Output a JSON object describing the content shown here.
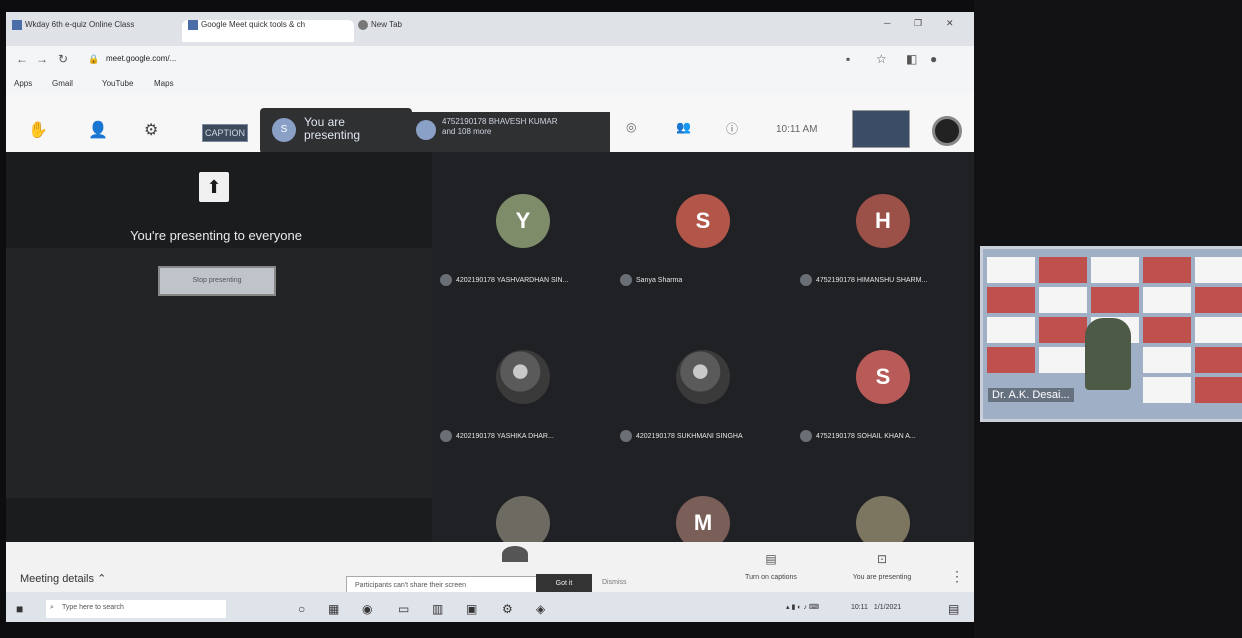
{
  "browser": {
    "tabs": [
      {
        "label": "Wkday 6th e-quiz Online Class",
        "active": false
      },
      {
        "label": "Google Meet quick tools & ch",
        "active": true
      },
      {
        "label": "New Tab",
        "active": false
      }
    ],
    "url": "meet.google.com/...",
    "bookmarks": [
      "Apps",
      "Gmail",
      "YouTube",
      "Maps"
    ]
  },
  "meet_top": {
    "recording_badge": "CAPTION",
    "presenting_label": "You are presenting",
    "presenting_avatar": "S",
    "presenter_name": "4752190178 BHAVESH KUMAR",
    "presenter_sub": "and 108 more",
    "time": "10:11 AM"
  },
  "presenting": {
    "title": "You're presenting to everyone",
    "stop_label": "Stop presenting"
  },
  "participants": [
    {
      "initial": "Y",
      "color": "#7f8c6a",
      "name": "4202190178 YASHVARDHAN SIN...",
      "photo": false
    },
    {
      "initial": "S",
      "color": "#b3564a",
      "name": "Sanya Sharma",
      "photo": false
    },
    {
      "initial": "H",
      "color": "#9b5048",
      "name": "4752190178 HIMANSHU SHARM...",
      "photo": false
    },
    {
      "initial": "",
      "color": "#555555",
      "name": "4202190178 YASHIKA DHAR...",
      "photo": true
    },
    {
      "initial": "",
      "color": "#555555",
      "name": "4202190178 SUKHMANI SINGHA",
      "photo": true
    },
    {
      "initial": "S",
      "color": "#b85a58",
      "name": "4752190178 SOHAIL KHAN A...",
      "photo": false
    },
    {
      "initial": "",
      "color": "#6d6a62",
      "name": "",
      "photo": true
    },
    {
      "initial": "M",
      "color": "#7a5e58",
      "name": "",
      "photo": false
    },
    {
      "initial": "",
      "color": "#7c7560",
      "name": "",
      "photo": true
    }
  ],
  "bottom": {
    "meeting_details": "Meeting details",
    "message_text": "Participants can't share their screen",
    "message_button": "Got it",
    "message_dismiss": "Dismiss",
    "turn_on_captions": "Turn on captions",
    "present_now": "You are presenting",
    "more": "⋮"
  },
  "taskbar": {
    "search_placeholder": "Type here to search",
    "tray_time": "10:11",
    "tray_date": "1/1/2021"
  },
  "external_video": {
    "name": "Dr. A.K. Desai..."
  }
}
